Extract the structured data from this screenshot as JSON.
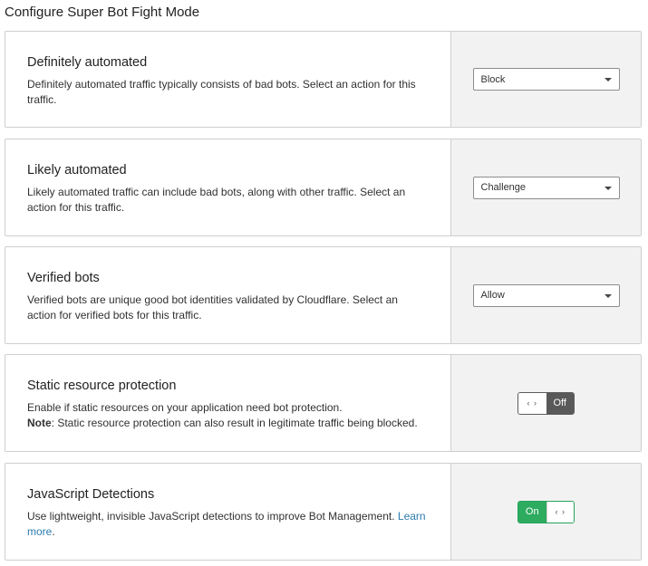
{
  "page": {
    "title": "Configure Super Bot Fight Mode"
  },
  "definitely_automated": {
    "title": "Definitely automated",
    "description": "Definitely automated traffic typically consists of bad bots. Select an action for this traffic.",
    "action": "Block"
  },
  "likely_automated": {
    "title": "Likely automated",
    "description": "Likely automated traffic can include bad bots, along with other traffic. Select an action for this traffic.",
    "action": "Challenge"
  },
  "verified_bots": {
    "title": "Verified bots",
    "description": "Verified bots are unique good bot identities validated by Cloudflare. Select an action for verified bots for this traffic.",
    "action": "Allow"
  },
  "static_resource_protection": {
    "title": "Static resource protection",
    "description": "Enable if static resources on your application need bot protection.",
    "note_label": "Note",
    "note_text": ": Static resource protection can also result in legitimate traffic being blocked.",
    "toggle_state": "Off",
    "toggle_knob": "‹ ›"
  },
  "javascript_detections": {
    "title": "JavaScript Detections",
    "description": "Use lightweight, invisible JavaScript detections to improve Bot Management.",
    "link_text": "Learn more",
    "link_suffix": ".",
    "toggle_state": "On",
    "toggle_knob": "‹ ›"
  },
  "colors": {
    "on_green": "#2dab5f",
    "off_gray": "#595959",
    "link_blue": "#2c7cb0",
    "panel_gray": "#f2f2f2"
  }
}
